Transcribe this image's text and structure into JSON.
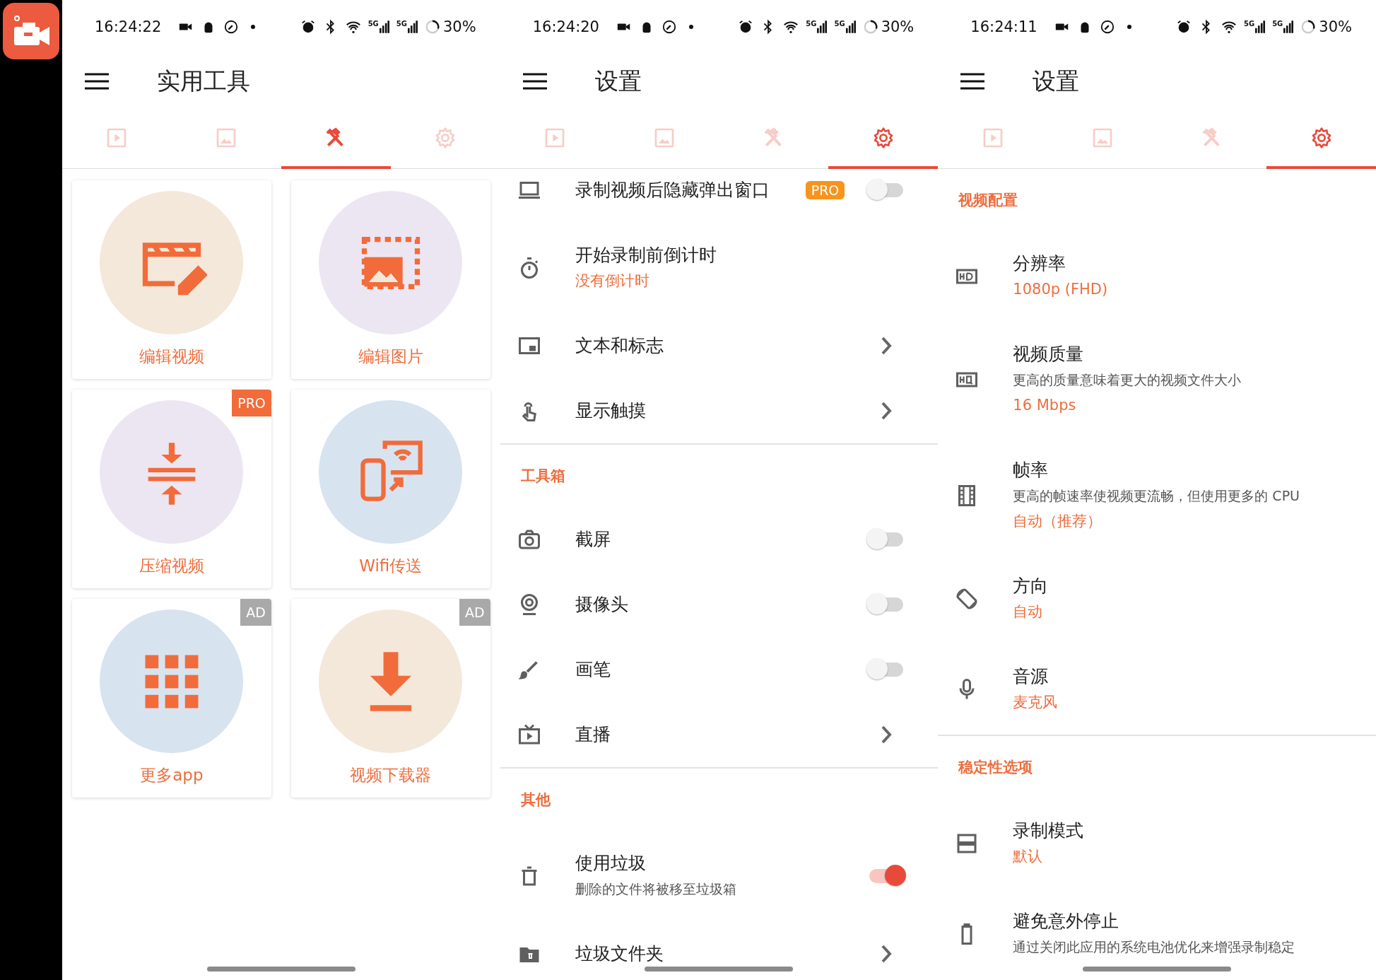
{
  "panels": [
    {
      "kind": "tools",
      "status_bar": {
        "time": "16:24:22",
        "signals": [
          "5G",
          "5G"
        ],
        "battery": "30%"
      },
      "title": "实用工具",
      "tabs": [
        {
          "kind": "video",
          "selected": false
        },
        {
          "kind": "image",
          "selected": false
        },
        {
          "kind": "tools",
          "selected": true
        },
        {
          "kind": "settings",
          "selected": false
        }
      ],
      "tools": [
        {
          "label": "编辑视频",
          "kind": "edit_video",
          "color": "#f3e8da"
        },
        {
          "label": "编辑图片",
          "kind": "edit_image",
          "color": "#ece6f2"
        },
        {
          "label": "压缩视频",
          "kind": "compress",
          "color": "#ece6f2",
          "badge": {
            "kind": "pro",
            "text": "PRO"
          }
        },
        {
          "label": "Wifi传送",
          "kind": "wifi",
          "color": "#d8e3f0"
        },
        {
          "label": "更多app",
          "kind": "apps",
          "color": "#d8e3f0",
          "badge": {
            "kind": "ad",
            "text": "AD"
          }
        },
        {
          "label": "视频下载器",
          "kind": "download",
          "color": "#f3e8da",
          "badge": {
            "kind": "ad",
            "text": "AD"
          }
        }
      ]
    },
    {
      "kind": "settings",
      "status_bar": {
        "time": "16:24:20",
        "signals": [
          "5G",
          "5G"
        ],
        "battery": "30%"
      },
      "title": "设置",
      "tabs": [
        {
          "kind": "video",
          "selected": false
        },
        {
          "kind": "image",
          "selected": false
        },
        {
          "kind": "tools",
          "selected": false
        },
        {
          "kind": "settings",
          "selected": true
        }
      ],
      "sections": [
        {
          "items": [
            {
              "kind": "switch",
              "title": "录制视频后隐藏弹出窗口",
              "badge": "PRO",
              "checked": false
            },
            {
              "kind": "plain",
              "title": "开始录制前倒计时",
              "value": "没有倒计时"
            },
            {
              "kind": "link",
              "title": "文本和标志"
            },
            {
              "kind": "link",
              "title": "显示触摸"
            }
          ]
        },
        {
          "header": "工具箱",
          "items": [
            {
              "kind": "switch",
              "title": "截屏",
              "checked": false
            },
            {
              "kind": "switch",
              "title": "摄像头",
              "checked": false
            },
            {
              "kind": "switch",
              "title": "画笔",
              "checked": false
            },
            {
              "kind": "link",
              "title": "直播"
            }
          ]
        },
        {
          "header": "其他",
          "items": [
            {
              "kind": "switch",
              "title": "使用垃圾",
              "description": "删除的文件将被移至垃圾箱",
              "checked": true
            },
            {
              "kind": "link",
              "title": "垃圾文件夹"
            }
          ]
        }
      ]
    },
    {
      "kind": "settings",
      "status_bar": {
        "time": "16:24:11",
        "signals": [
          "5G",
          "5G"
        ],
        "battery": "30%"
      },
      "title": "设置",
      "tabs": [
        {
          "kind": "video",
          "selected": false
        },
        {
          "kind": "image",
          "selected": false
        },
        {
          "kind": "tools",
          "selected": false
        },
        {
          "kind": "settings",
          "selected": true
        }
      ],
      "sections": [
        {
          "header": "视频配置",
          "items": [
            {
              "kind": "plain",
              "title": "分辨率",
              "value": "1080p (FHD)"
            },
            {
              "kind": "plain",
              "title": "视频质量",
              "description": "更高的质量意味着更大的视频文件大小",
              "value": "16 Mbps"
            },
            {
              "kind": "plain",
              "title": "帧率",
              "description": "更高的帧速率使视频更流畅，但使用更多的 CPU",
              "value": "自动（推荐）"
            },
            {
              "kind": "plain",
              "title": "方向",
              "value": "自动"
            },
            {
              "kind": "plain",
              "title": "音源",
              "value": "麦克风"
            }
          ]
        },
        {
          "header": "稳定性选项",
          "items": [
            {
              "kind": "plain",
              "title": "录制模式",
              "value": "默认"
            },
            {
              "kind": "plain",
              "title": "避免意外停止",
              "description": "通过关闭此应用的系统电池优化来增强录制稳定"
            }
          ]
        }
      ]
    }
  ]
}
